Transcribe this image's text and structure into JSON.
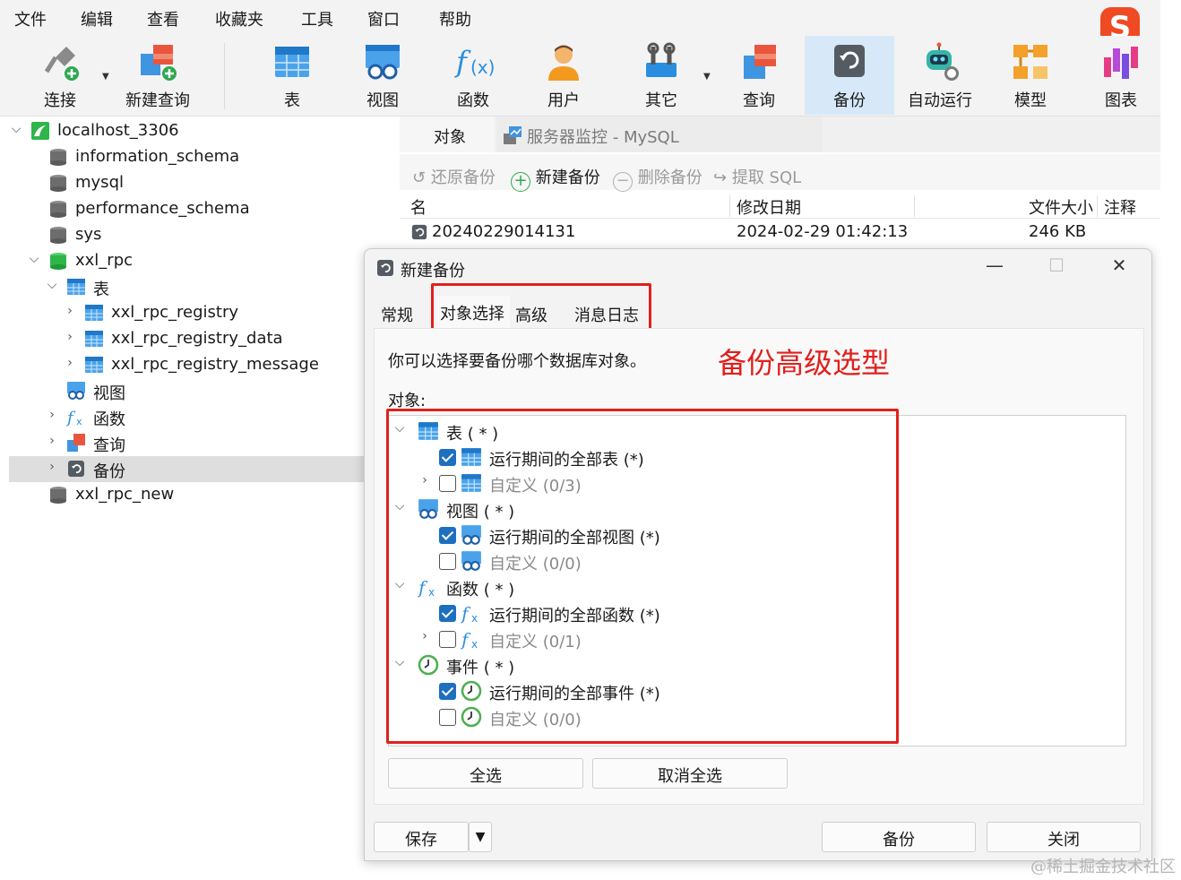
{
  "menu": [
    "文件",
    "编辑",
    "查看",
    "收藏夹",
    "工具",
    "窗口",
    "帮助"
  ],
  "brand_logo_text": "S",
  "toolbar": {
    "connect": "连接",
    "new_query": "新建查询",
    "table": "表",
    "view": "视图",
    "function": "函数",
    "user": "用户",
    "other": "其它",
    "query": "查询",
    "backup": "备份",
    "auto_run": "自动运行",
    "model": "模型",
    "chart": "图表"
  },
  "tree": {
    "connection": "localhost_3306",
    "databases": [
      "information_schema",
      "mysql",
      "performance_schema",
      "sys",
      "xxl_rpc"
    ],
    "tables_node": "表",
    "tables": [
      "xxl_rpc_registry",
      "xxl_rpc_registry_data",
      "xxl_rpc_registry_message"
    ],
    "views_node": "视图",
    "functions_node": "函数",
    "queries_node": "查询",
    "backups_node": "备份",
    "last_db": "xxl_rpc_new"
  },
  "tabs": {
    "objects": "对象",
    "monitor": "服务器监控 - MySQL"
  },
  "object_toolbar": {
    "restore": "还原备份",
    "new": "新建备份",
    "delete": "删除备份",
    "extract": "提取 SQL"
  },
  "list": {
    "headers": {
      "name": "名",
      "modified": "修改日期",
      "size": "文件大小",
      "comment": "注释"
    },
    "row": {
      "name": "20240229014131",
      "modified": "2024-02-29 01:42:13",
      "size": "246 KB"
    }
  },
  "dialog": {
    "title": "新建备份",
    "tabs": [
      "常规",
      "对象选择",
      "高级",
      "消息日志"
    ],
    "description": "你可以选择要备份哪个数据库对象。",
    "annotation": "备份高级选型",
    "objects_label": "对象:",
    "groups": {
      "table": {
        "label": "表 ( * )",
        "all": "运行期间的全部表 (*)",
        "custom": "自定义 (0/3)"
      },
      "view": {
        "label": "视图 ( * )",
        "all": "运行期间的全部视图 (*)",
        "custom": "自定义 (0/0)"
      },
      "function": {
        "label": "函数 ( * )",
        "all": "运行期间的全部函数 (*)",
        "custom": "自定义 (0/1)"
      },
      "event": {
        "label": "事件 ( * )",
        "all": "运行期间的全部事件 (*)",
        "custom": "自定义 (0/0)"
      }
    },
    "select_all": "全选",
    "deselect_all": "取消全选",
    "save": "保存",
    "backup": "备份",
    "close": "关闭"
  },
  "watermark": "@稀土掘金技术社区",
  "colors": {
    "accent_blue": "#1d6fbf",
    "annotation_red": "#e0201c",
    "active_toolbar": "#d7e9f8"
  }
}
